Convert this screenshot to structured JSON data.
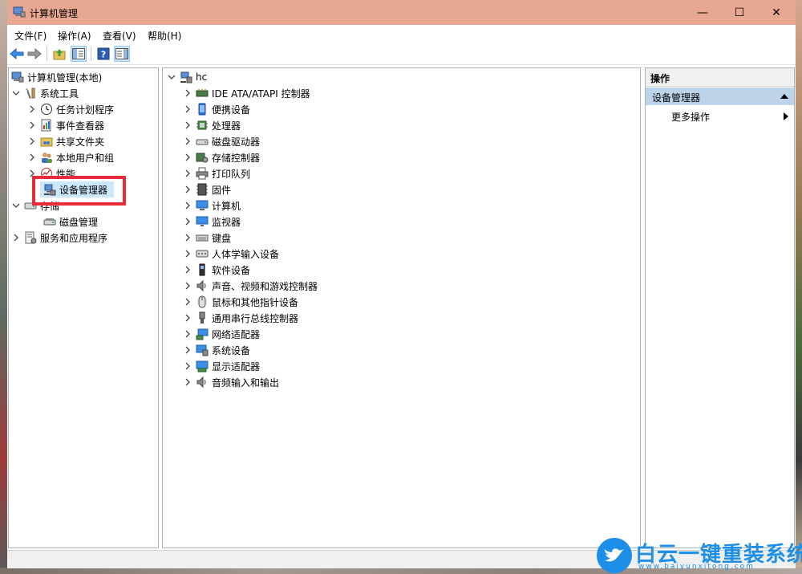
{
  "window": {
    "title": "计算机管理",
    "minimize": "—",
    "maximize": "☐",
    "close": "✕"
  },
  "menu": [
    "文件(F)",
    "操作(A)",
    "查看(V)",
    "帮助(H)"
  ],
  "left_tree": {
    "root": "计算机管理(本地)",
    "system_tools": "系统工具",
    "task_scheduler": "任务计划程序",
    "event_viewer": "事件查看器",
    "shared_folders": "共享文件夹",
    "local_users": "本地用户和组",
    "performance": "性能",
    "device_manager": "设备管理器",
    "storage": "存储",
    "disk_management": "磁盘管理",
    "services_apps": "服务和应用程序"
  },
  "device_tree": {
    "root": "hc",
    "categories": [
      {
        "label": "IDE ATA/ATAPI 控制器",
        "icon": "ide-controller-icon"
      },
      {
        "label": "便携设备",
        "icon": "portable-device-icon"
      },
      {
        "label": "处理器",
        "icon": "processor-icon"
      },
      {
        "label": "磁盘驱动器",
        "icon": "disk-drive-icon"
      },
      {
        "label": "存储控制器",
        "icon": "storage-controller-icon"
      },
      {
        "label": "打印队列",
        "icon": "printer-icon"
      },
      {
        "label": "固件",
        "icon": "firmware-icon"
      },
      {
        "label": "计算机",
        "icon": "computer-icon"
      },
      {
        "label": "监视器",
        "icon": "monitor-icon"
      },
      {
        "label": "键盘",
        "icon": "keyboard-icon"
      },
      {
        "label": "人体学输入设备",
        "icon": "hid-icon"
      },
      {
        "label": "软件设备",
        "icon": "software-device-icon"
      },
      {
        "label": "声音、视频和游戏控制器",
        "icon": "speaker-icon"
      },
      {
        "label": "鼠标和其他指针设备",
        "icon": "mouse-icon"
      },
      {
        "label": "通用串行总线控制器",
        "icon": "usb-icon"
      },
      {
        "label": "网络适配器",
        "icon": "network-adapter-icon"
      },
      {
        "label": "系统设备",
        "icon": "system-device-icon"
      },
      {
        "label": "显示适配器",
        "icon": "display-adapter-icon"
      },
      {
        "label": "音频输入和输出",
        "icon": "audio-io-icon"
      }
    ]
  },
  "actions": {
    "header": "操作",
    "group": "设备管理器",
    "more": "更多操作"
  },
  "watermark": {
    "text": "白云一键重装系统",
    "url": "www.baiyunxitong.com"
  },
  "colors": {
    "titlebar": "#e8a790",
    "selection": "#cce8ff",
    "highlight_box": "#ea2b3a",
    "action_group": "#bcd3ea",
    "watermark": "#1d8fe8"
  }
}
